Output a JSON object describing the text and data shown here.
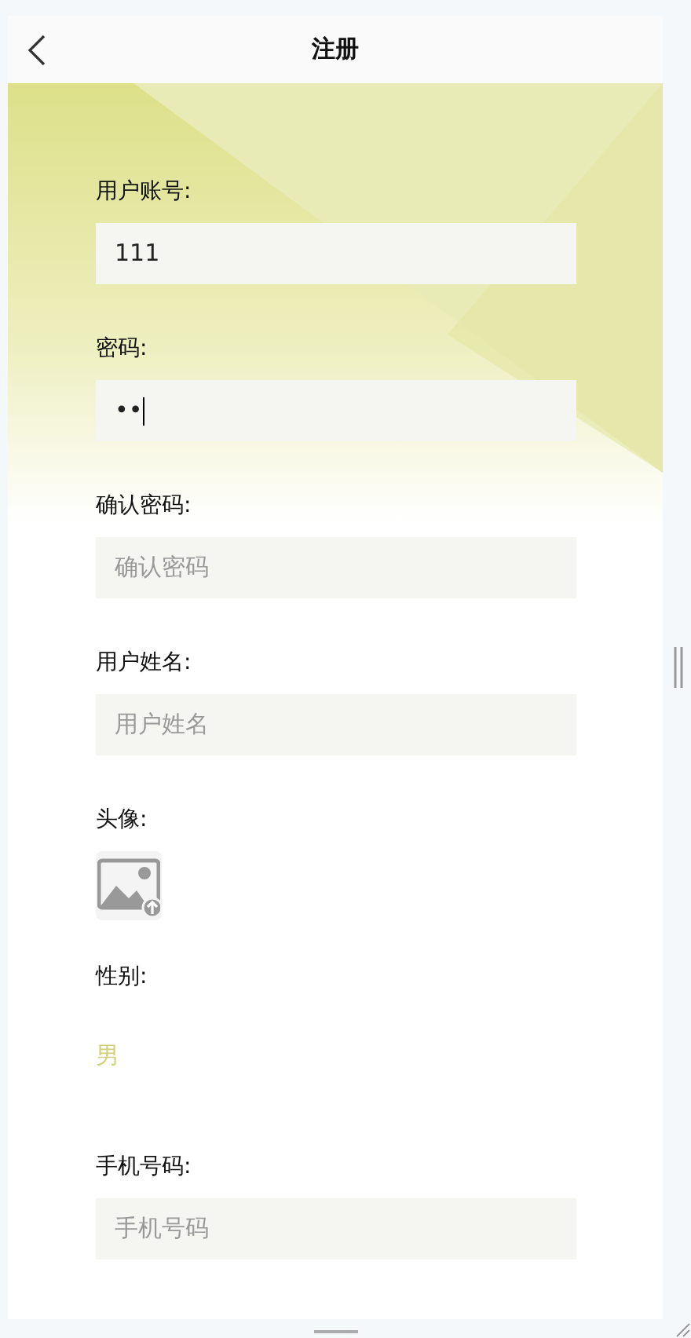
{
  "header": {
    "title": "注册"
  },
  "fields": [
    {
      "kind": "text",
      "label": "用户账号:",
      "value": "111"
    },
    {
      "kind": "text",
      "label": "密码:",
      "value": "••",
      "focused": true
    },
    {
      "kind": "text",
      "label": "确认密码:",
      "placeholder": "确认密码"
    },
    {
      "kind": "text",
      "label": "用户姓名:",
      "placeholder": "用户姓名"
    },
    {
      "kind": "image",
      "label": "头像:"
    },
    {
      "kind": "radio",
      "label": "性别:",
      "options": [
        {
          "label": "男",
          "selected": true
        }
      ]
    },
    {
      "kind": "text",
      "label": "手机号码:",
      "placeholder": "手机号码"
    }
  ]
}
